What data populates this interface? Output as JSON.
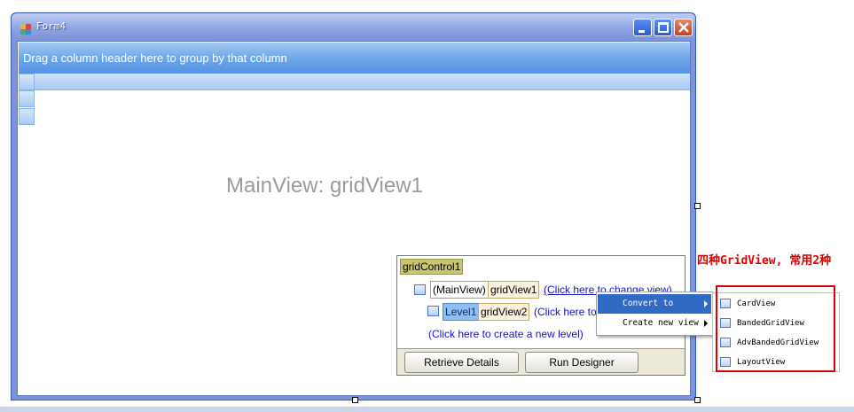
{
  "window": {
    "title": "Form4"
  },
  "grid": {
    "group_panel_text": "Drag a column header here to group by that column",
    "main_view_caption": "MainView: gridView1"
  },
  "designer": {
    "control_label": "gridControl1",
    "main_level_label": "(MainView)",
    "main_view_name": "gridView1",
    "main_change_link": "(Click here to change view)",
    "level1_label": "Level1",
    "level1_view_name": "gridView2",
    "level1_change_link": "(Click here to",
    "create_view_link": "(Click here to create a new level)",
    "retrieve_button": "Retrieve Details",
    "run_designer_button": "Run Designer"
  },
  "context_menu": {
    "items": [
      {
        "label": "Convert to",
        "highlighted": true,
        "has_submenu": true
      },
      {
        "label": "Create new view",
        "highlighted": false,
        "has_submenu": true
      }
    ]
  },
  "submenu": {
    "items": [
      {
        "label": "CardView",
        "icon": "card-view-icon"
      },
      {
        "label": "BandedGridView",
        "icon": "banded-grid-icon"
      },
      {
        "label": "AdvBandedGridView",
        "icon": "adv-banded-grid-icon"
      },
      {
        "label": "LayoutView",
        "icon": "layout-view-icon"
      }
    ]
  },
  "annotation": {
    "text": "四种GridView, 常用2种"
  },
  "colors": {
    "accent": "#316ac5",
    "annotation": "#e00000",
    "group_panel": "#6fa7ea"
  }
}
